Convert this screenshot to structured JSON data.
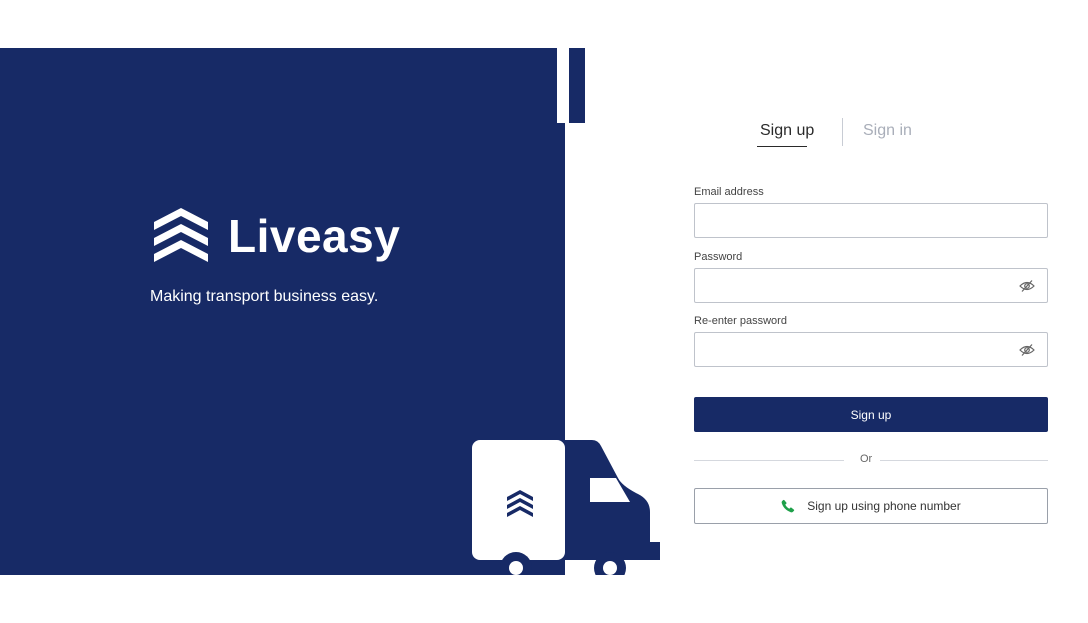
{
  "brand": {
    "name": "Liveasy",
    "tagline": "Making transport business easy."
  },
  "auth": {
    "tabs": [
      {
        "label": "Sign up",
        "active": true
      },
      {
        "label": "Sign in",
        "active": false
      }
    ],
    "fields": {
      "email": {
        "label": "Email address",
        "value": "",
        "placeholder": ""
      },
      "password": {
        "label": "Password",
        "value": "",
        "placeholder": ""
      },
      "confirm": {
        "label": "Re-enter password",
        "value": "",
        "placeholder": ""
      }
    },
    "submit_label": "Sign up",
    "divider_text": "Or",
    "phone_label": "Sign up using phone number"
  },
  "icons": {
    "logo": "chevron-stack-logo",
    "eye": "eye-slash-icon",
    "phone": "phone-icon"
  },
  "colors": {
    "brand_navy": "#172a66",
    "phone_green": "#1fa04a",
    "muted_tab": "#a9aeb9"
  }
}
